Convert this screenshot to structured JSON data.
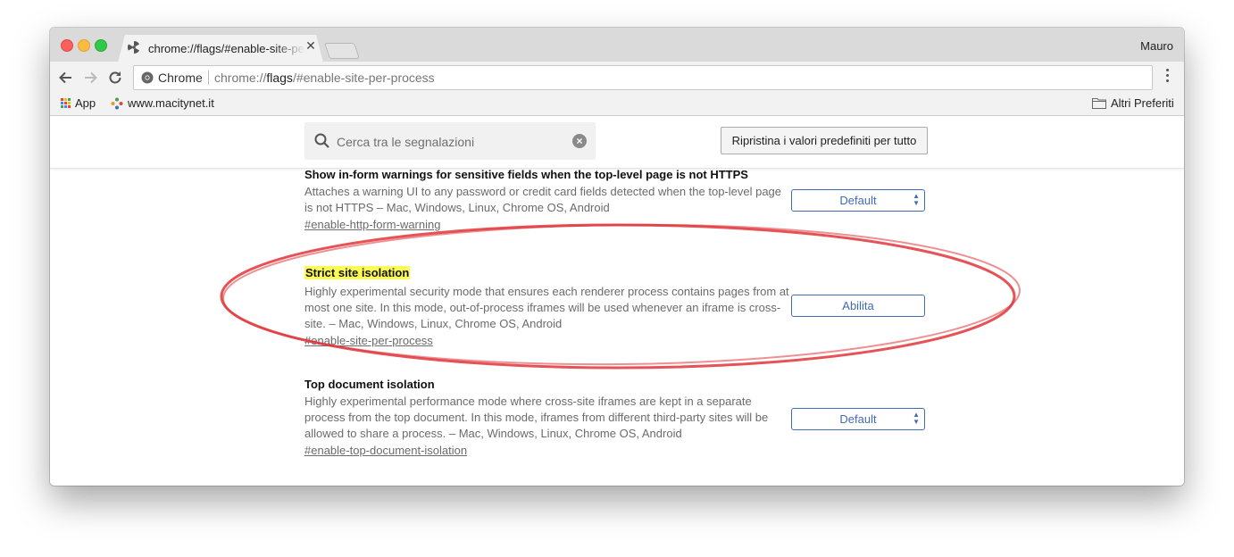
{
  "window": {
    "tab_title": "chrome://flags/#enable-site-per-process",
    "profile_name": "Mauro"
  },
  "omnibox": {
    "chip": "Chrome",
    "url_scheme": "chrome://",
    "url_host": "flags",
    "url_rest": "/#enable-site-per-process"
  },
  "bookmarks": {
    "apps_label": "App",
    "site_label": "www.macitynet.it",
    "other_label": "Altri Preferiti"
  },
  "flags": {
    "search_placeholder": "Cerca tra le segnalazioni",
    "reset_label": "Ripristina i valori predefiniti per tutto",
    "experiments": [
      {
        "title": "Show in-form warnings for sensitive fields when the top-level page is not HTTPS",
        "description": "Attaches a warning UI to any password or credit card fields detected when the top-level page is not HTTPS  – Mac, Windows, Linux, Chrome OS, Android",
        "link": "#enable-http-form-warning",
        "value": "Default"
      },
      {
        "title": "Strict site isolation",
        "description": "Highly experimental security mode that ensures each renderer process contains pages from at most one site. In this mode, out-of-process iframes will be used whenever an iframe is cross-site.  – Mac, Windows, Linux, Chrome OS, Android",
        "link": "#enable-site-per-process",
        "value": "Abilita"
      },
      {
        "title": "Top document isolation",
        "description": "Highly experimental performance mode where cross-site iframes are kept in a separate process from the top document. In this mode, iframes from different third-party sites will be allowed to share a process.  – Mac, Windows, Linux, Chrome OS, Android",
        "link": "#enable-top-document-isolation",
        "value": "Default"
      }
    ]
  },
  "colors": {
    "highlight": "#fcfb53",
    "annotation": "#e0353a",
    "select_accent": "#3f6bb4"
  }
}
